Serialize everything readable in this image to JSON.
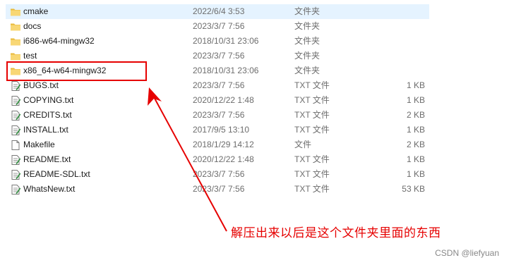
{
  "files": [
    {
      "name": "cmake",
      "date": "2022/6/4 3:53",
      "type": "文件夹",
      "size": "",
      "icon": "folder-icon",
      "selected": true
    },
    {
      "name": "docs",
      "date": "2023/3/7 7:56",
      "type": "文件夹",
      "size": "",
      "icon": "folder-icon",
      "selected": false
    },
    {
      "name": "i686-w64-mingw32",
      "date": "2018/10/31 23:06",
      "type": "文件夹",
      "size": "",
      "icon": "folder-icon",
      "selected": false
    },
    {
      "name": "test",
      "date": "2023/3/7 7:56",
      "type": "文件夹",
      "size": "",
      "icon": "folder-icon",
      "selected": false
    },
    {
      "name": "x86_64-w64-mingw32",
      "date": "2018/10/31 23:06",
      "type": "文件夹",
      "size": "",
      "icon": "folder-icon",
      "selected": false
    },
    {
      "name": "BUGS.txt",
      "date": "2023/3/7 7:56",
      "type": "TXT 文件",
      "size": "1 KB",
      "icon": "text-file-icon",
      "selected": false
    },
    {
      "name": "COPYING.txt",
      "date": "2020/12/22 1:48",
      "type": "TXT 文件",
      "size": "1 KB",
      "icon": "text-file-icon",
      "selected": false
    },
    {
      "name": "CREDITS.txt",
      "date": "2023/3/7 7:56",
      "type": "TXT 文件",
      "size": "2 KB",
      "icon": "text-file-icon",
      "selected": false
    },
    {
      "name": "INSTALL.txt",
      "date": "2017/9/5 13:10",
      "type": "TXT 文件",
      "size": "1 KB",
      "icon": "text-file-icon",
      "selected": false
    },
    {
      "name": "Makefile",
      "date": "2018/1/29 14:12",
      "type": "文件",
      "size": "2 KB",
      "icon": "blank-file-icon",
      "selected": false
    },
    {
      "name": "README.txt",
      "date": "2020/12/22 1:48",
      "type": "TXT 文件",
      "size": "1 KB",
      "icon": "text-file-icon",
      "selected": false
    },
    {
      "name": "README-SDL.txt",
      "date": "2023/3/7 7:56",
      "type": "TXT 文件",
      "size": "1 KB",
      "icon": "text-file-icon",
      "selected": false
    },
    {
      "name": "WhatsNew.txt",
      "date": "2023/3/7 7:56",
      "type": "TXT 文件",
      "size": "53 KB",
      "icon": "text-file-icon",
      "selected": false
    }
  ],
  "annotation": {
    "text": "解压出来以后是这个文件夹里面的东西",
    "color": "#e60000"
  },
  "watermark": "CSDN @liefyuan",
  "colors": {
    "selected_row": "#e5f3ff",
    "folder": "#f5c542",
    "annotation": "#e60000"
  }
}
